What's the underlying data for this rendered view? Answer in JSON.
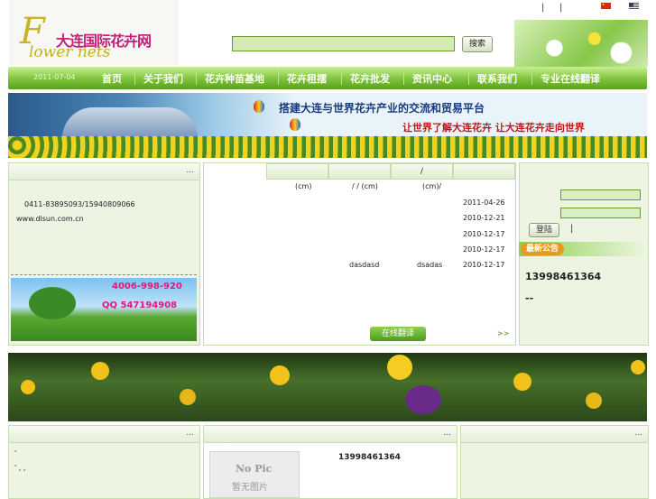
{
  "header": {
    "logo_cn": "大连国际花卉网",
    "logo_en": "lower nets",
    "logo_initial": "F",
    "search_button": "搜索",
    "search_value": "",
    "topbar_separators": [
      "|",
      "|",
      "|"
    ],
    "flags": [
      "china-flag",
      "usa-flag"
    ]
  },
  "nav": {
    "date": "2011-07-04",
    "items": [
      "首页",
      "关于我们",
      "花卉种苗基地",
      "花卉租摆",
      "花卉批发",
      "资讯中心",
      "联系我们",
      "专业在线翻译"
    ]
  },
  "banner": {
    "slogan_main": "搭建大连与世界花卉产业的交流和贸易平台",
    "slogan_sub": "让世界了解大连花卉 让大连花卉走向世界"
  },
  "left_panel": {
    "more": "...",
    "phone": "0411-83895093/15940809066",
    "website": "www.dlsun.com.cn",
    "ad_phone1": "4006-998-920",
    "ad_phone2": "QQ  547194908"
  },
  "mid_panel": {
    "tabs": [
      "",
      "",
      "",
      "/",
      "",
      ""
    ],
    "header_row": [
      "(cm)",
      "/ / (cm)",
      "(cm)/"
    ],
    "dates": [
      "2011-04-26",
      "2010-12-21",
      "2010-12-17",
      "2010-12-17",
      "2010-12-17"
    ],
    "last_row": [
      "dasdasd",
      "dsadas"
    ],
    "translate_button": "在线翻译",
    "more_link": ">>"
  },
  "right_panel": {
    "login_button": "登陆",
    "separator": "|",
    "notice_title": "最新公告",
    "notice_phone": "13998461364",
    "notice_extra": "--"
  },
  "bottom": {
    "left_more": "...",
    "mid_more": "...",
    "right_more": "...",
    "left_bullets": [
      "'",
      "' ,  ,"
    ],
    "nopic_en": "No Pic",
    "nopic_cn": "暂无图片",
    "phone": "13998461364"
  },
  "colors": {
    "nav_green": "#7ec23a",
    "panel_bg": "#edf5e2",
    "ad_pink": "#e01880",
    "logo_magenta": "#c3207a"
  }
}
